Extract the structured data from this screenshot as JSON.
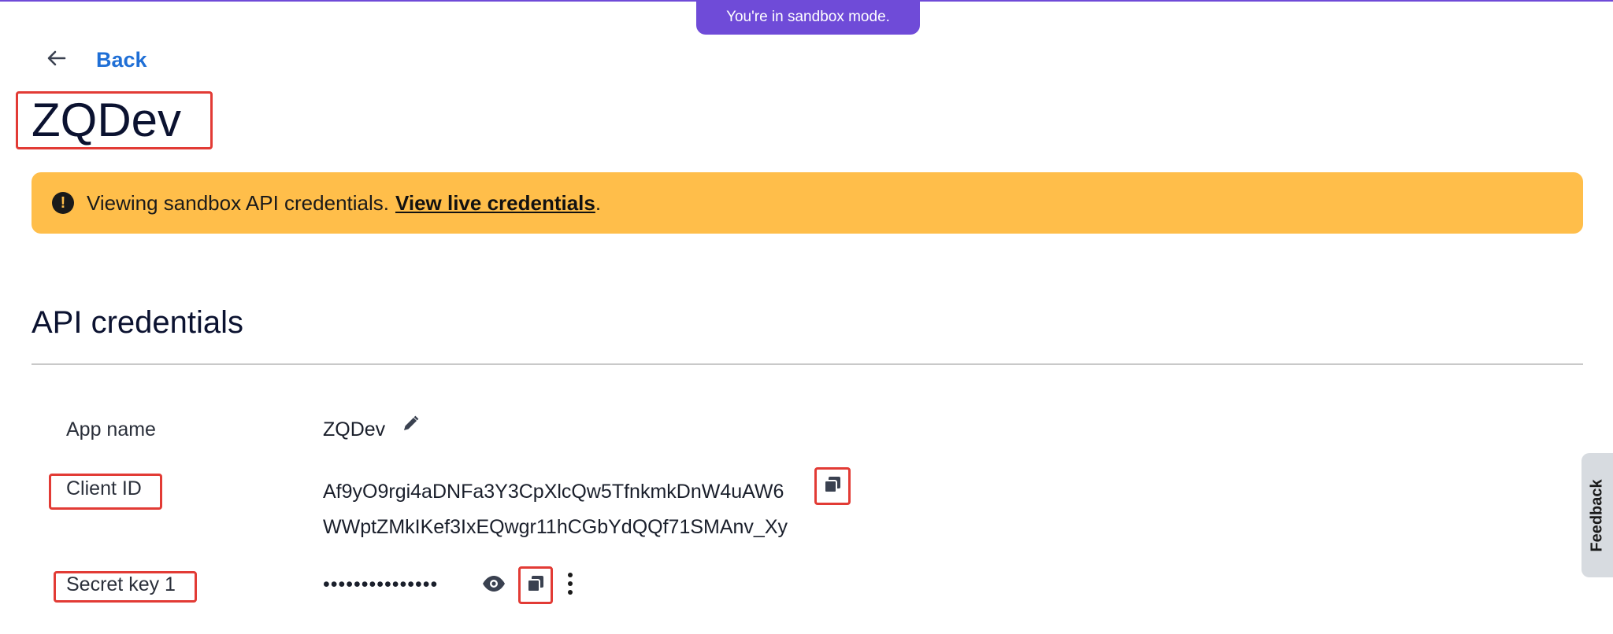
{
  "sandbox_banner": {
    "text": "You're in sandbox mode."
  },
  "nav": {
    "back_label": "Back"
  },
  "app": {
    "title": "ZQDev"
  },
  "notice": {
    "text": "Viewing sandbox API credentials.",
    "link_label": "View live credentials",
    "suffix": "."
  },
  "credentials": {
    "section_title": "API credentials",
    "app_name_label": "App name",
    "app_name_value": "ZQDev",
    "client_id_label": "Client ID",
    "client_id_line1": "Af9yO9rgi4aDNFa3Y3CpXlcQw5TfnkmkDnW4uAW6",
    "client_id_line2": "WWptZMkIKef3IxEQwgr11hCGbYdQQf71SMAnv_Xy",
    "secret_key_label": "Secret key 1",
    "secret_key_masked": "•••••••••••••••"
  },
  "feedback": {
    "label": "Feedback"
  },
  "icons": {
    "back": "arrow-left-icon",
    "alert": "exclamation-circle-icon",
    "edit": "pencil-icon",
    "copy": "copy-icon",
    "show": "eye-icon",
    "more": "more-vertical-icon"
  },
  "colors": {
    "accent_purple": "#6f4bd8",
    "link_blue": "#1f6fd6",
    "banner_yellow": "#ffbe4a",
    "highlight_red": "#e23b35"
  }
}
